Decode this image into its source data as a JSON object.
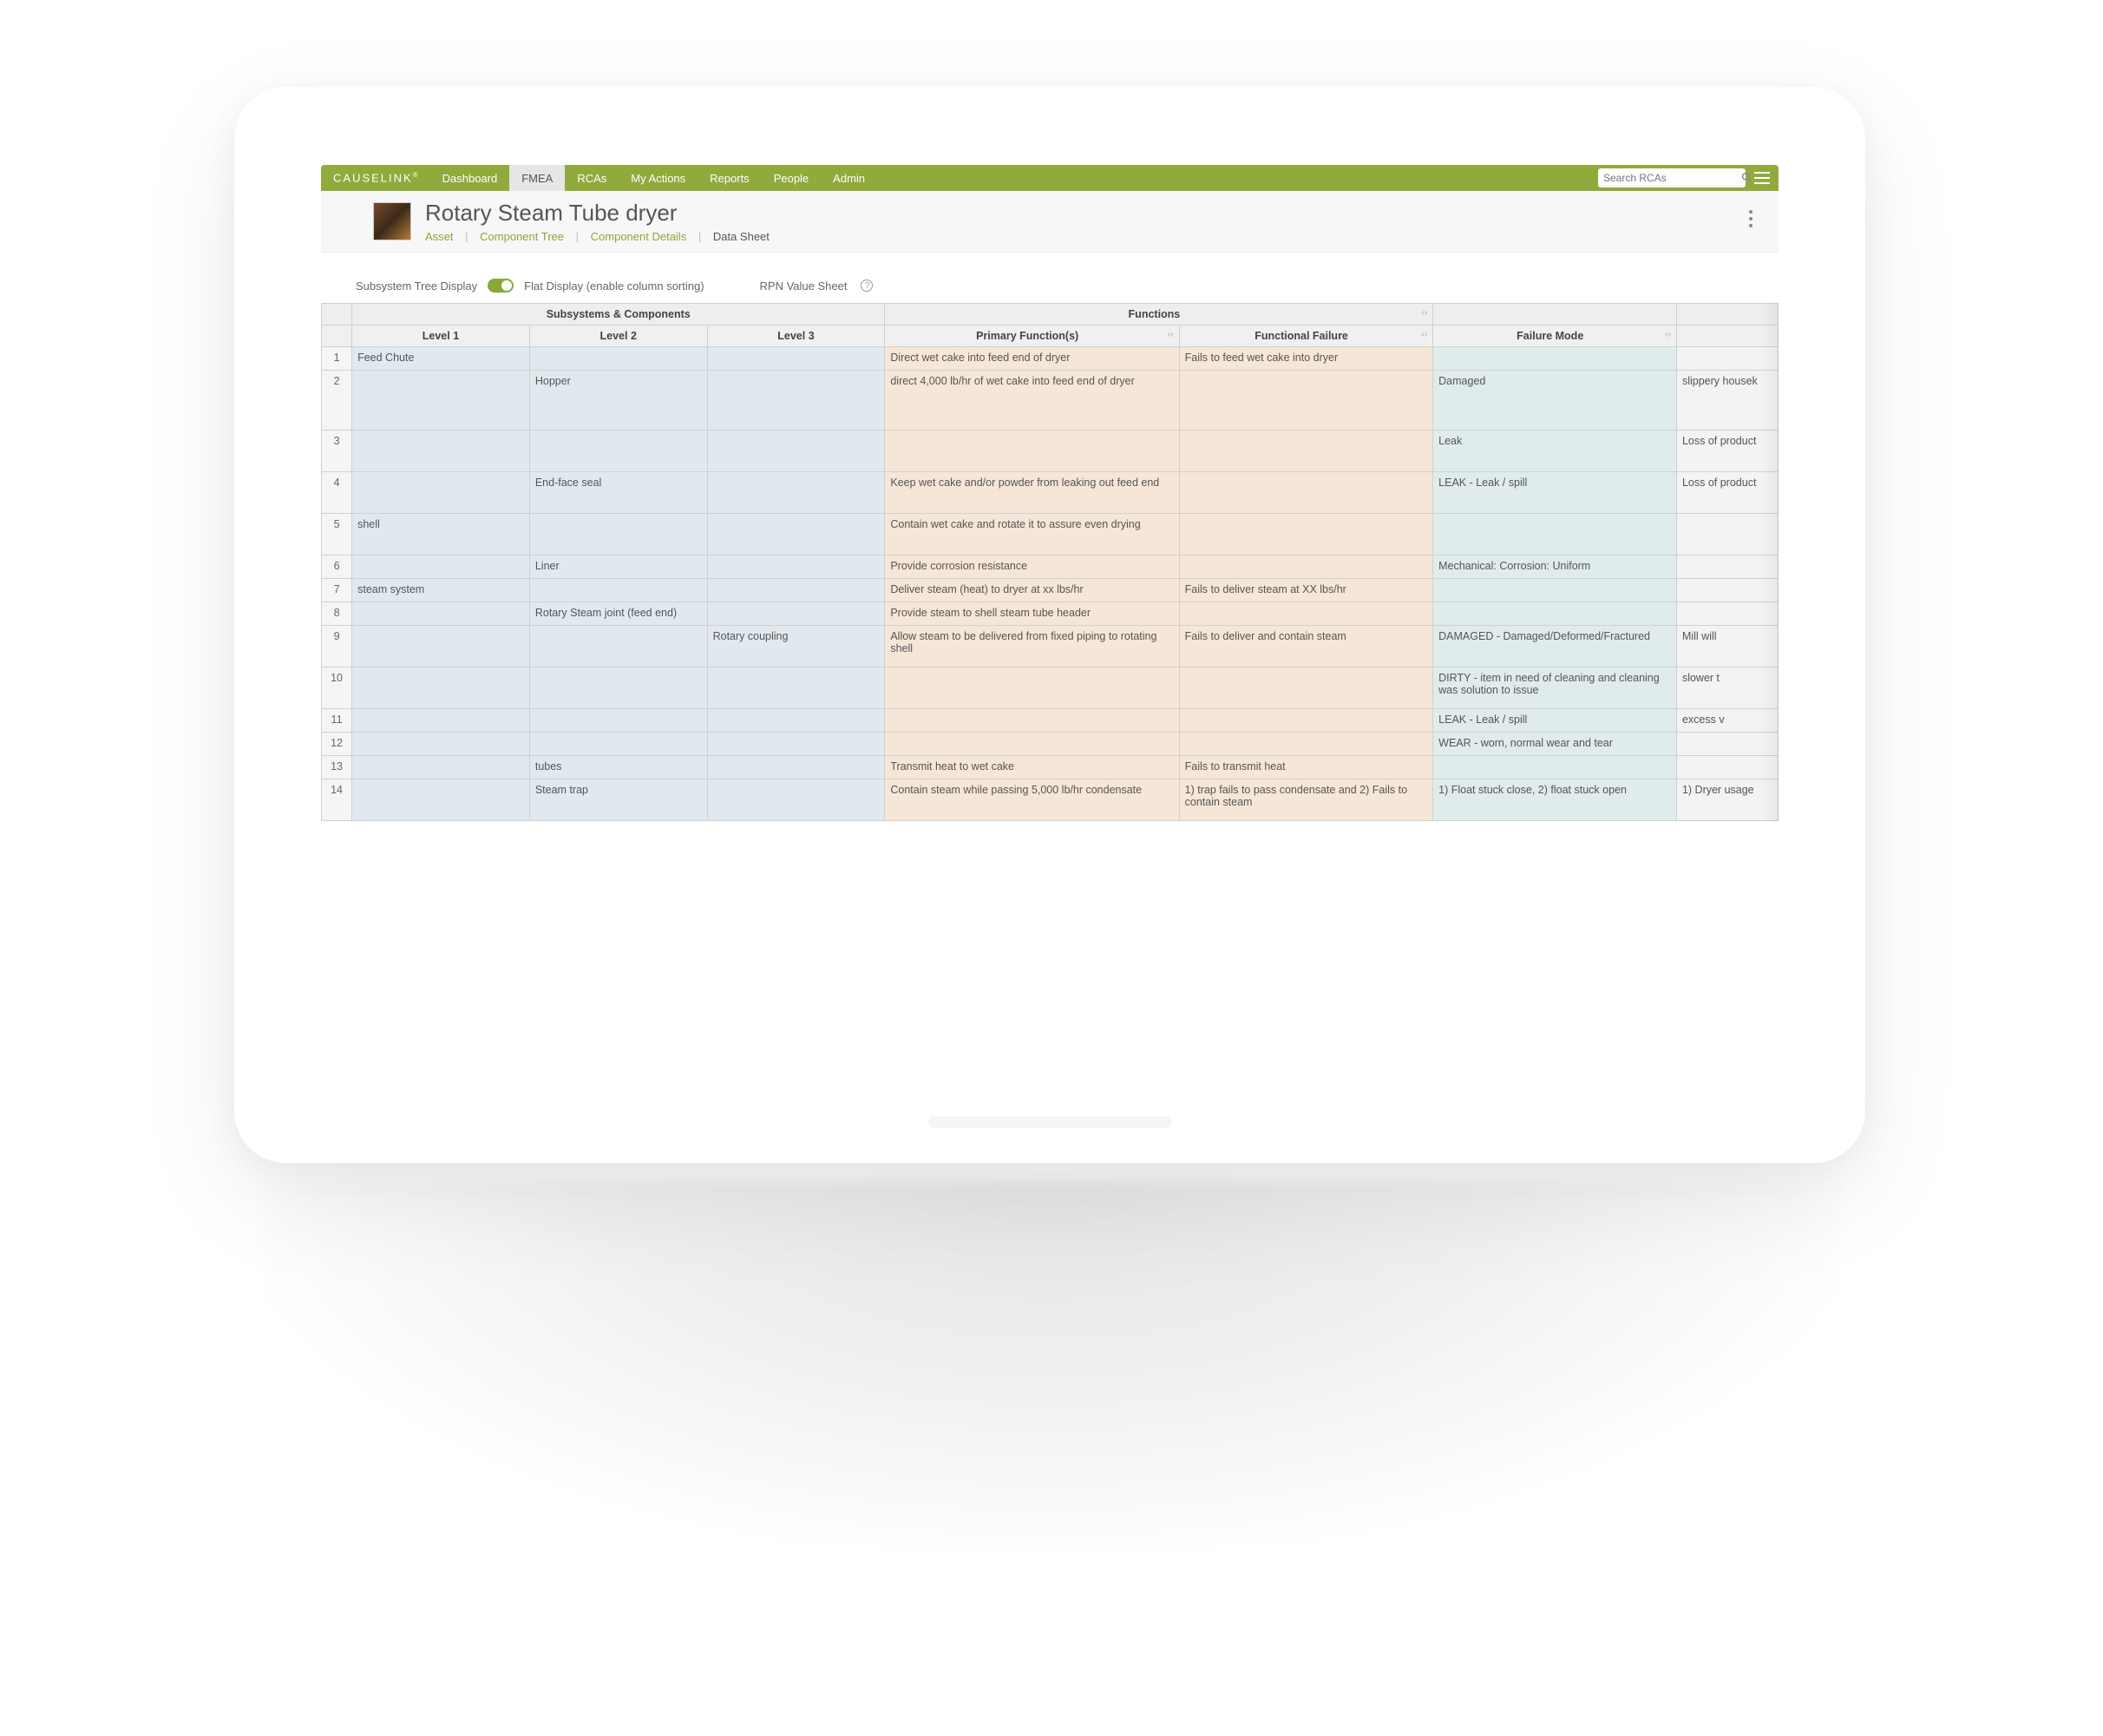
{
  "brand": "CAUSELINK",
  "nav": {
    "items": [
      "Dashboard",
      "FMEA",
      "RCAs",
      "My Actions",
      "Reports",
      "People",
      "Admin"
    ],
    "active_index": 1
  },
  "search": {
    "placeholder": "Search RCAs"
  },
  "page": {
    "title": "Rotary Steam Tube dryer",
    "breadcrumbs": {
      "asset": "Asset",
      "component_tree": "Component Tree",
      "component_details": "Component Details",
      "current": "Data Sheet"
    }
  },
  "toolbar": {
    "subsystem_label": "Subsystem Tree Display",
    "flat_label": "Flat Display (enable column sorting)",
    "rpn_label": "RPN Value Sheet"
  },
  "table": {
    "group_headers": {
      "subsystems": "Subsystems & Components",
      "functions": "Functions"
    },
    "columns": {
      "level1": "Level 1",
      "level2": "Level 2",
      "level3": "Level 3",
      "primary_function": "Primary Function(s)",
      "functional_failure": "Functional Failure",
      "failure_mode": "Failure Mode"
    },
    "rows": [
      {
        "n": "1",
        "l1": "Feed Chute",
        "l2": "",
        "l3": "",
        "pf": "Direct wet cake into feed end of dryer",
        "ff": "Fails to feed wet cake into dryer",
        "fm": "",
        "ex": ""
      },
      {
        "n": "2",
        "l1": "",
        "l2": "Hopper",
        "l3": "",
        "pf": "direct 4,000 lb/hr of wet cake into feed end of dryer",
        "ff": "",
        "fm": "Damaged",
        "ex": "slippery housek"
      },
      {
        "n": "3",
        "l1": "",
        "l2": "",
        "l3": "",
        "pf": "",
        "ff": "",
        "fm": "Leak",
        "ex": "Loss of product"
      },
      {
        "n": "4",
        "l1": "",
        "l2": "End-face seal",
        "l3": "",
        "pf": "Keep wet cake and/or powder from leaking out feed end",
        "ff": "",
        "fm": "LEAK - Leak / spill",
        "ex": "Loss of product"
      },
      {
        "n": "5",
        "l1": "shell",
        "l2": "",
        "l3": "",
        "pf": "Contain wet cake and rotate it to assure even drying",
        "ff": "",
        "fm": "",
        "ex": ""
      },
      {
        "n": "6",
        "l1": "",
        "l2": "Liner",
        "l3": "",
        "pf": "Provide corrosion resistance",
        "ff": "",
        "fm": "Mechanical: Corrosion: Uniform",
        "ex": ""
      },
      {
        "n": "7",
        "l1": "steam system",
        "l2": "",
        "l3": "",
        "pf": "Deliver steam (heat) to dryer at xx lbs/hr",
        "ff": "Fails to deliver steam at XX lbs/hr",
        "fm": "",
        "ex": ""
      },
      {
        "n": "8",
        "l1": "",
        "l2": "Rotary Steam joint (feed end)",
        "l3": "",
        "pf": "Provide steam to shell steam tube header",
        "ff": "",
        "fm": "",
        "ex": ""
      },
      {
        "n": "9",
        "l1": "",
        "l2": "",
        "l3": "Rotary coupling",
        "pf": "Allow steam to be delivered from fixed piping to rotating shell",
        "ff": "Fails to deliver and contain steam",
        "fm": "DAMAGED - Damaged/Deformed/Fractured",
        "ex": "Mill will"
      },
      {
        "n": "10",
        "l1": "",
        "l2": "",
        "l3": "",
        "pf": "",
        "ff": "",
        "fm": "DIRTY - item in need of cleaning and cleaning was solution to issue",
        "ex": "slower t"
      },
      {
        "n": "11",
        "l1": "",
        "l2": "",
        "l3": "",
        "pf": "",
        "ff": "",
        "fm": "LEAK - Leak / spill",
        "ex": "excess v"
      },
      {
        "n": "12",
        "l1": "",
        "l2": "",
        "l3": "",
        "pf": "",
        "ff": "",
        "fm": "WEAR - worn, normal wear and tear",
        "ex": ""
      },
      {
        "n": "13",
        "l1": "",
        "l2": "tubes",
        "l3": "",
        "pf": "Transmit heat to wet cake",
        "ff": "Fails to transmit heat",
        "fm": "",
        "ex": ""
      },
      {
        "n": "14",
        "l1": "",
        "l2": "Steam trap",
        "l3": "",
        "pf": "Contain steam while passing 5,000 lb/hr condensate",
        "ff": "1) trap fails to pass condensate and 2) Fails to contain steam",
        "fm": "1) Float stuck close, 2) float stuck open",
        "ex": "1) Dryer usage"
      }
    ]
  }
}
